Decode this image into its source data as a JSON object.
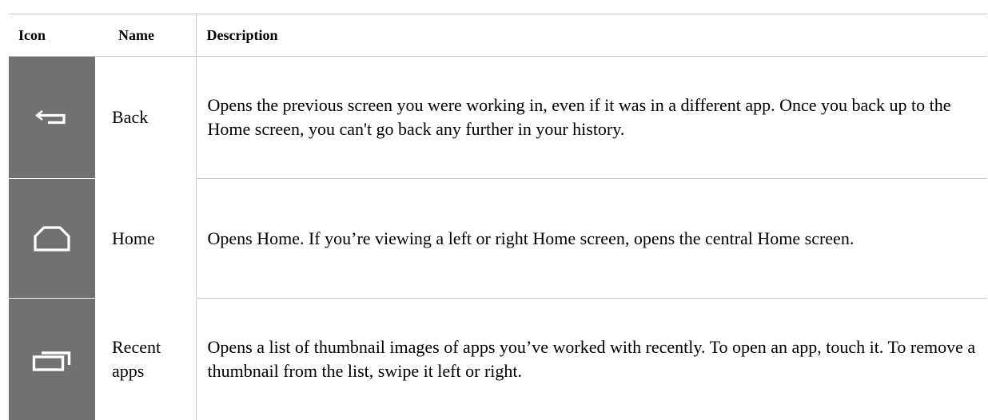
{
  "headers": {
    "icon": "Icon",
    "name": "Name",
    "description": "Description"
  },
  "rows": [
    {
      "icon": "back-arrow-icon",
      "name": "Back",
      "description": "Opens the previous screen you were working in, even if it was in a different app. Once you back up to the Home screen, you can't go back any further in your history."
    },
    {
      "icon": "home-icon",
      "name": "Home",
      "description": "Opens Home. If you’re viewing a left or right Home screen, opens the central Home screen."
    },
    {
      "icon": "recent-apps-icon",
      "name": "Recent apps",
      "description": "Opens a list of thumbnail images of apps you’ve worked with recently. To open an app, touch it. To remove a thumbnail from the list, swipe it left or right."
    }
  ],
  "colors": {
    "icon_background": "#717171",
    "icon_foreground": "#ffffff",
    "rule": "#c8c8c8"
  }
}
